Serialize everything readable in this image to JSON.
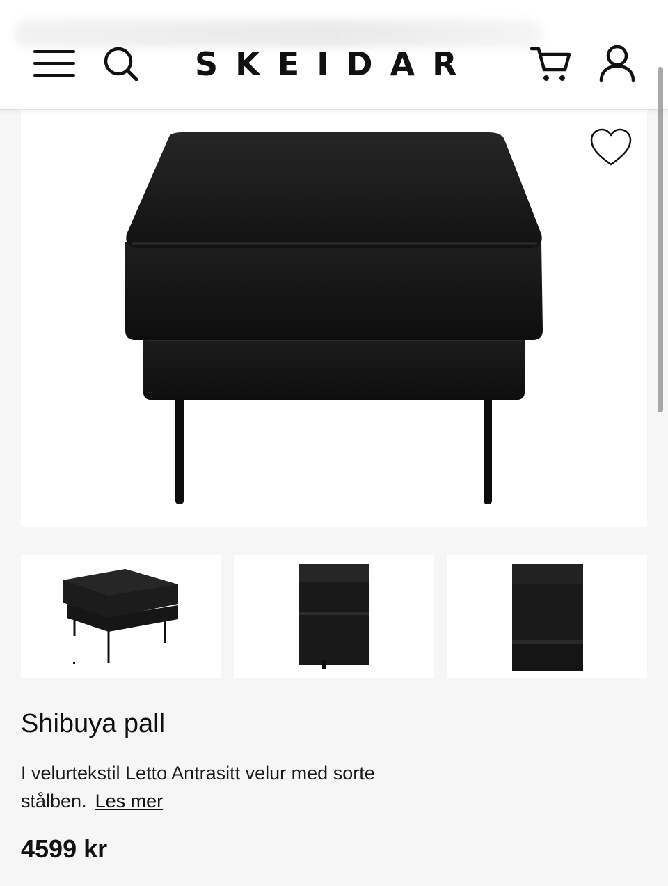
{
  "header": {
    "brand": "SKEIDAR",
    "icons": [
      "menu-icon",
      "search-icon",
      "cart-icon",
      "user-icon"
    ]
  },
  "product": {
    "title": "Shibuya pall",
    "description": "I velurtekstil Letto Antrasitt velur med sorte stålben.",
    "read_more": "Les mer",
    "price": "4599 kr",
    "favorite_icon": "heart-icon"
  },
  "gallery": {
    "thumbnails": [
      "ottoman-angle-view",
      "ottoman-corner-detail",
      "fabric-close-up"
    ]
  },
  "colors": {
    "header_bg": "#ffffff",
    "page_bg": "#f6f6f6",
    "product_fabric": "#1b1b1b",
    "text": "#111111"
  }
}
